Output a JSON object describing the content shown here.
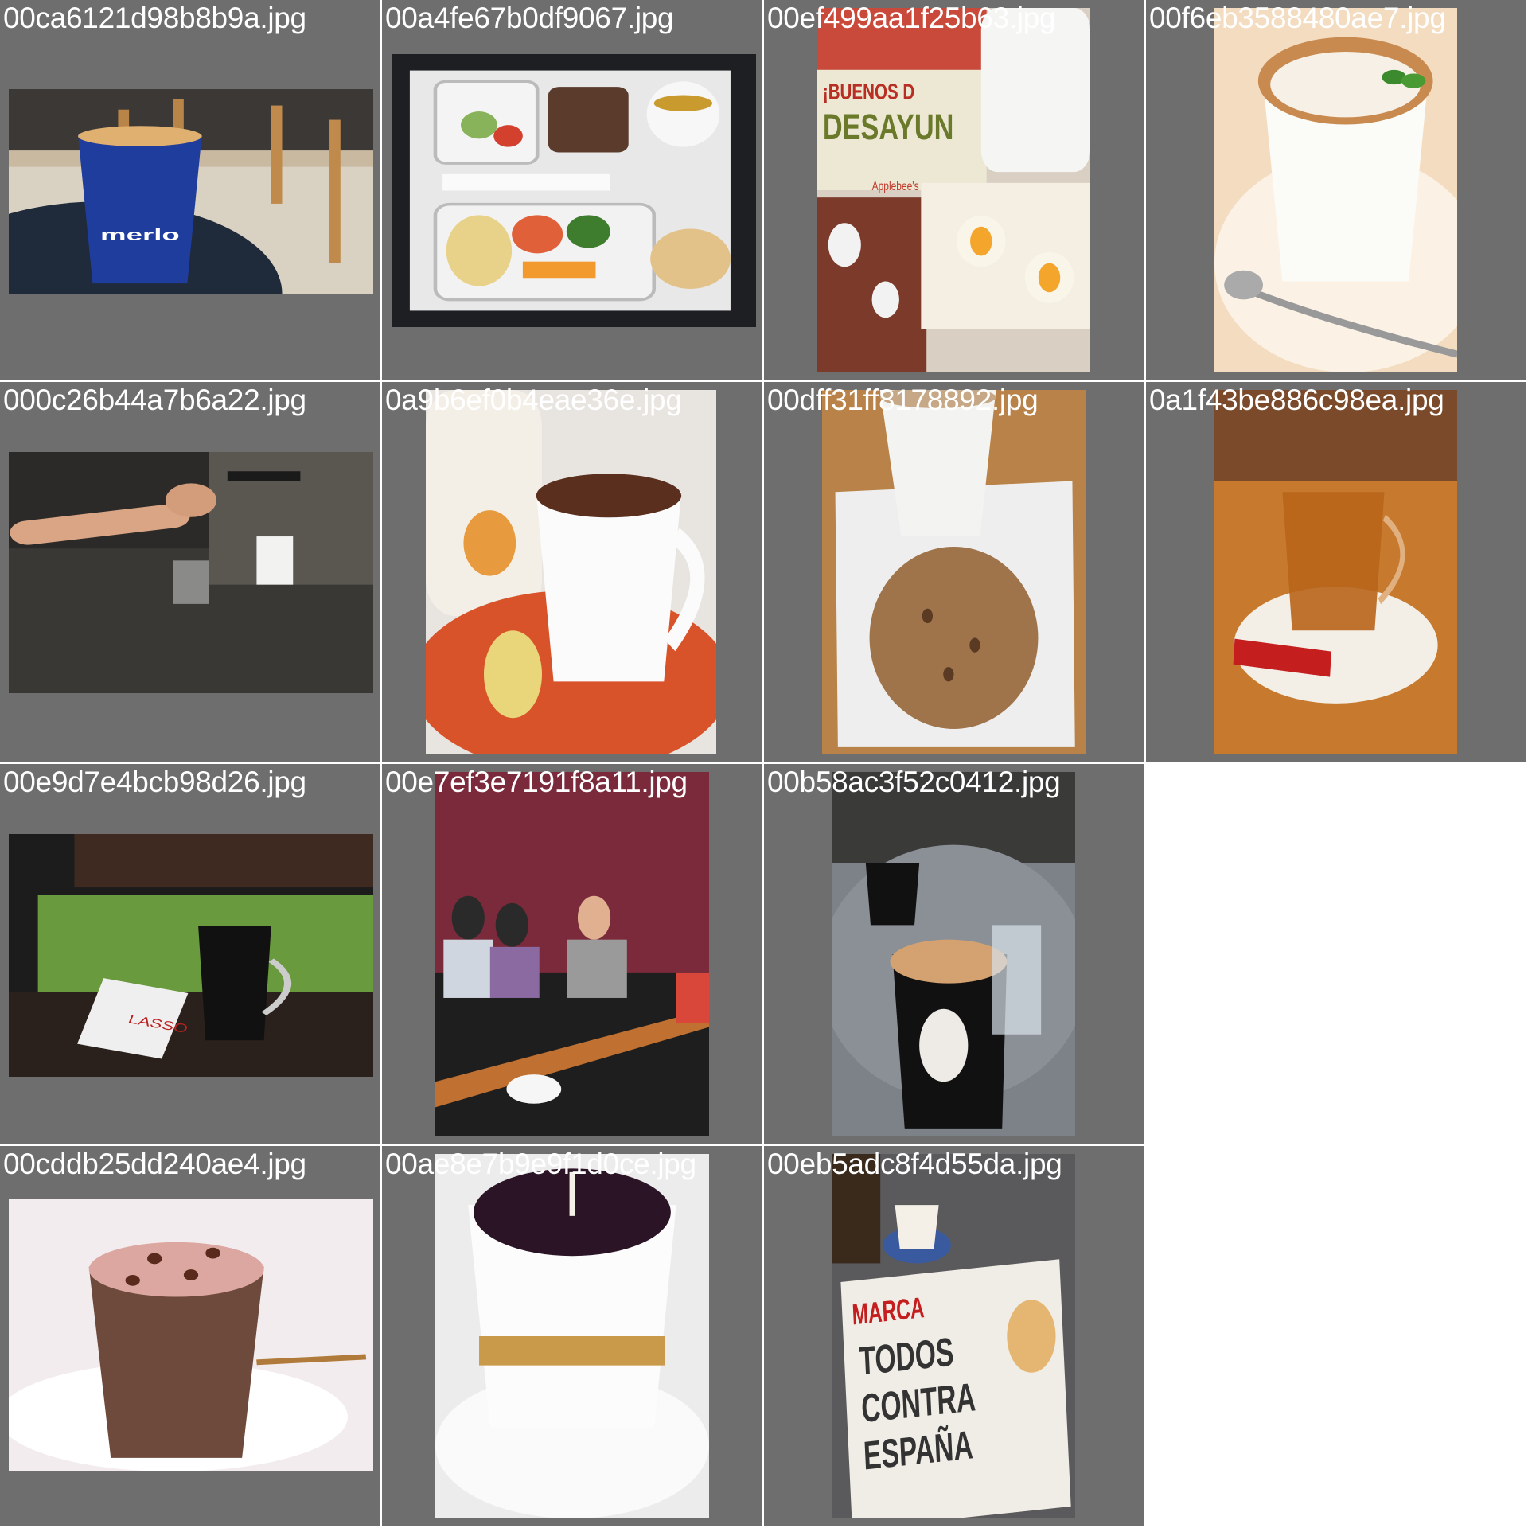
{
  "background": "#ffffff",
  "cell_color": "#6e6e6e",
  "label_color": "#ffffff",
  "tiles": [
    {
      "filename": "00ca6121d98b8b9a.jpg",
      "subject": "blue paper coffee cup on cafe table"
    },
    {
      "filename": "00a4fe67b0df9067.jpg",
      "subject": "airline meal tray with pasta, salad, cake and tea"
    },
    {
      "filename": "00ef499aa1f25b63.jpg",
      "subject": "breakfast menu with fried eggs and coffee mug",
      "photo_text": [
        "¡BUENOS D",
        "DESAYUN",
        "Applebee's"
      ]
    },
    {
      "filename": "00f6eb3588480ae7.jpg",
      "subject": "cappuccino with mint leaf in white cup"
    },
    {
      "filename": "000c26b44a7b6a22.jpg",
      "subject": "barista operating espresso machine"
    },
    {
      "filename": "0a9b6ef0b4eae36e.jpg",
      "subject": "white mug of tea with teapot and cake on orange mat"
    },
    {
      "filename": "00dff31ff8178892.jpg",
      "subject": "paper coffee cup with muffin on paper"
    },
    {
      "filename": "0a1f43be886c98ea.jpg",
      "subject": "glass mug of tea on saucer"
    },
    {
      "filename": "00e9d7e4bcb98d26.jpg",
      "subject": "glass mug of black coffee by window with cigarette pack",
      "photo_text": [
        "LASSO"
      ]
    },
    {
      "filename": "00e7ef3e7191f8a11.jpg",
      "subject": "people at cafe table with small cups"
    },
    {
      "filename": "00b58ac3f52c0412.jpg",
      "subject": "Marilyn mug of coffee and glass of water on table"
    },
    {
      "filename": "00cddb25dd240ae4.jpg",
      "subject": "hot chocolate with cocoa sprinkles in glass"
    },
    {
      "filename": "00ae8e7b9e9f1d0ce.jpg",
      "subject": "coffee cup candle on saucer"
    },
    {
      "filename": "00eb5adc8f4d55da.jpg",
      "subject": "espresso cup with Marca newspaper",
      "photo_text": [
        "MARCA",
        "TODOS",
        "CONTRA",
        "ESPAÑA"
      ]
    }
  ]
}
